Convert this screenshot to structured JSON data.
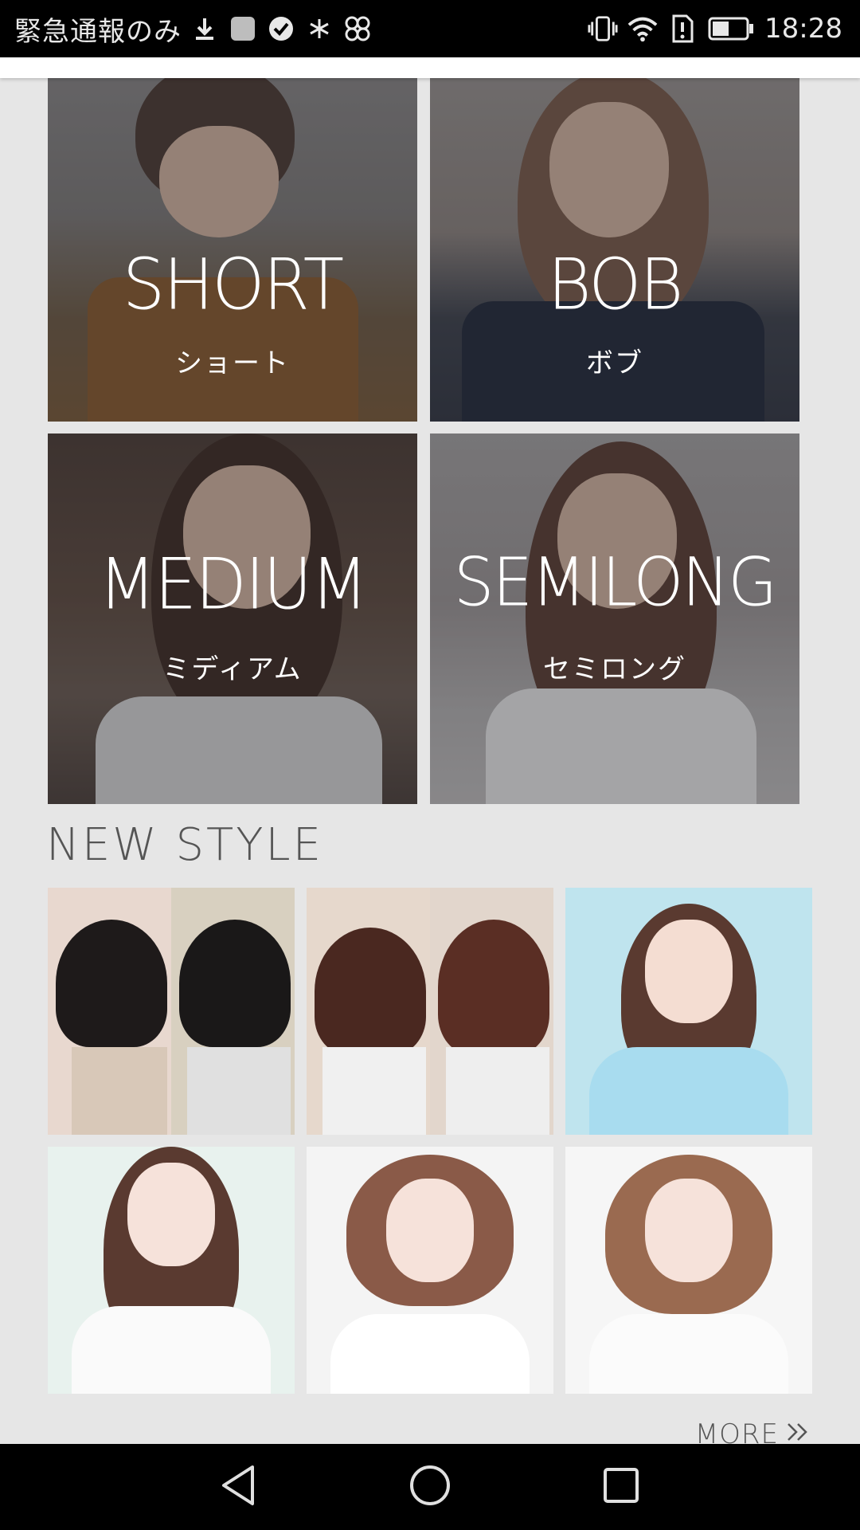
{
  "status_bar": {
    "carrier": "緊急通報のみ",
    "time": "18:28",
    "icons": [
      "download-icon",
      "square-icon",
      "check-circle-icon",
      "snowflake-icon",
      "fan-icon",
      "vibrate-icon",
      "wifi-icon",
      "alert-icon",
      "battery-icon"
    ]
  },
  "categories": [
    {
      "label_en": "SHORT",
      "label_jp": "ショート"
    },
    {
      "label_en": "BOB",
      "label_jp": "ボブ"
    },
    {
      "label_en": "MEDIUM",
      "label_jp": "ミディアム"
    },
    {
      "label_en": "SEMILONG",
      "label_jp": "セミロング"
    }
  ],
  "new_style": {
    "title": "NEW STYLE",
    "more_label": "MORE",
    "thumbnails": [
      "hairstyle-photo",
      "hairstyle-photo",
      "hairstyle-photo",
      "hairstyle-photo",
      "hairstyle-photo",
      "hairstyle-photo"
    ]
  },
  "nav_bar": {
    "buttons": [
      "back-icon",
      "home-icon",
      "recent-apps-icon"
    ]
  },
  "colors": {
    "background": "#e6e6e6",
    "status_bar": "#000000",
    "text_dark": "#555555",
    "label_white": "#ffffff"
  }
}
